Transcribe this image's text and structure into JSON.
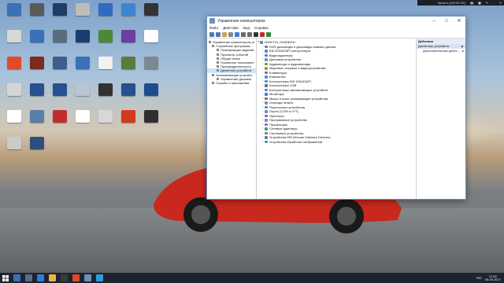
{
  "recorder_bar": {
    "label": "Запись [00:02:00]",
    "controls": [
      "▮▮",
      "■",
      "✎",
      "–",
      "✕"
    ]
  },
  "desktop_icons": [
    {
      "label": "",
      "color": "#3a71b8"
    },
    {
      "label": "",
      "color": "#5a5a5a"
    },
    {
      "label": "",
      "color": "#1f3c66"
    },
    {
      "label": "",
      "color": "#c0bdb8"
    },
    {
      "label": "",
      "color": "#2f6bbf"
    },
    {
      "label": "",
      "color": "#3d86cf"
    },
    {
      "label": "",
      "color": "#333"
    },
    {
      "label": "",
      "color": "#d7d7d7"
    },
    {
      "label": "",
      "color": "#3a71b8"
    },
    {
      "label": "",
      "color": "#5b6c7d"
    },
    {
      "label": "",
      "color": "#1a3d70"
    },
    {
      "label": "",
      "color": "#4b8a33"
    },
    {
      "label": "",
      "color": "#6b3fa0"
    },
    {
      "label": "",
      "color": "#ffffff"
    },
    {
      "label": "",
      "color": "#e24b2a"
    },
    {
      "label": "",
      "color": "#7b2c1d"
    },
    {
      "label": "",
      "color": "#3b5e8c"
    },
    {
      "label": "",
      "color": "#3a71b8"
    },
    {
      "label": "",
      "color": "#f2f2f2"
    },
    {
      "label": "",
      "color": "#5d7b3a"
    },
    {
      "label": "",
      "color": "#7a8a90"
    },
    {
      "label": "",
      "color": "#d5d5d5"
    },
    {
      "label": "",
      "color": "#27508f"
    },
    {
      "label": "",
      "color": "#27508f"
    },
    {
      "label": "",
      "color": "#b8c5d3"
    },
    {
      "label": "",
      "color": "#333"
    },
    {
      "label": "",
      "color": "#27508f"
    },
    {
      "label": "",
      "color": "#1d4d8c"
    },
    {
      "label": "",
      "color": "#ffffff"
    },
    {
      "label": "",
      "color": "#5a7fa8"
    },
    {
      "label": "",
      "color": "#c12d2d"
    },
    {
      "label": "",
      "color": "#ffffff"
    },
    {
      "label": "",
      "color": "#d7d7d7"
    },
    {
      "label": "",
      "color": "#d23a1e"
    },
    {
      "label": "",
      "color": "#2f2f2f"
    },
    {
      "label": "",
      "color": "#cbcbcb"
    },
    {
      "label": "",
      "color": "#2e4e80"
    }
  ],
  "window": {
    "title": "Управление компьютером",
    "menu": [
      "Файл",
      "Действие",
      "Вид",
      "Справка"
    ],
    "tree": [
      {
        "label": "Управление компьютером (л",
        "selected": false
      },
      {
        "label": "Служебные программы",
        "selected": false
      },
      {
        "label": "Планировщик заданий",
        "selected": false
      },
      {
        "label": "Просмотр событий",
        "selected": false
      },
      {
        "label": "Общие папки",
        "selected": false
      },
      {
        "label": "Локальные пользовате",
        "selected": false
      },
      {
        "label": "Производительность",
        "selected": false
      },
      {
        "label": "Диспетчер устройств",
        "selected": true
      },
      {
        "label": "Запоминающие устройст",
        "selected": false
      },
      {
        "label": "Управление дисками",
        "selected": false
      },
      {
        "label": "Службы и приложения",
        "selected": false
      }
    ],
    "device_root": "WINCTKL-G03GBOH",
    "devices": [
      "DVD-дисководы и дисководы компакт-дисков",
      "IDE ATA/ATAPI контроллеры",
      "Видеоадаптеры",
      "Дисковые устройства",
      "Аудиовходы и аудиовыходы",
      "Звуковые, игровые и видеоустройства",
      "Клавиатуры",
      "Компьютер",
      "Контроллеры IDE ATA/ATAPI",
      "Контроллеры USB",
      "Контроллеры запоминающих устройств",
      "Мониторы",
      "Мыши и иные указывающие устройства",
      "Очереди печати",
      "Переносные устройства",
      "Порты (COM и LPT)",
      "Принтеры",
      "Программные устройства",
      "Процессоры",
      "Сетевые адаптеры",
      "Системные устройства",
      "Устройства HID (Human Interface Devices)",
      "Устройства обработки изображений"
    ],
    "actions_header": "Действия",
    "actions_section": "Диспетчер устройств",
    "actions_item": "Дополнительные дейст..."
  },
  "taskbar": {
    "time": "17:02",
    "date": "05.05.2017",
    "lang": "РУС"
  }
}
